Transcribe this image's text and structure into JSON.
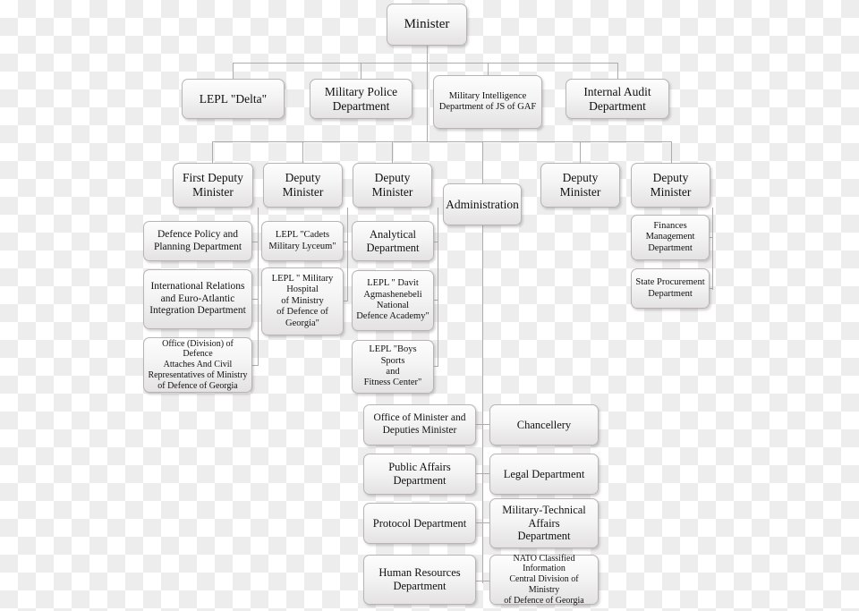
{
  "diagram": {
    "title": "Ministry of Defence of Georgia organizational structure",
    "colors": {
      "box_border": "#b9b4b4",
      "box_fill_top": "#fdfdfd",
      "box_fill_bottom": "#e4e2e2",
      "connector": "#b0abab",
      "text": "#111111",
      "canvas_checker_light": "#ffffff",
      "canvas_checker_dark": "#ededed"
    },
    "nodes": {
      "minister": "Minister",
      "lepl_delta": "LEPL \"Delta\"",
      "military_police": "Military Police\nDepartment",
      "military_intelligence": "Military Intelligence\nDepartment of JS of GAF",
      "internal_audit": "Internal Audit\nDepartment",
      "first_deputy_minister": "First Deputy\nMinister",
      "deputy_minister_2": "Deputy\nMinister",
      "deputy_minister_3": "Deputy\nMinister",
      "deputy_minister_5": "Deputy\nMinister",
      "deputy_minister_6": "Deputy\nMinister",
      "administration": "Administration",
      "defence_policy": "Defence Policy and\nPlanning Department",
      "international_relations": "International Relations\nand Euro-Atlantic\nIntegration Department",
      "office_defence_attaches": "Office (Division) of Defence\nAttaches And Civil\nRepresentatives of Ministry\nof Defence of Georgia",
      "lepl_cadets": "LEPL \"Cadets\nMilitary Lyceum\"",
      "lepl_military_hospital": "LEPL \" Military\nHospital\nof Ministry\nof Defence of\nGeorgia\"",
      "analytical_department": "Analytical\nDepartment",
      "lepl_davit_academy": "LEPL \" Davit\nAgmashenebeli\nNational\nDefence Academy\"",
      "lepl_boys_sports": "LEPL \"Boys Sports\nand\nFitness Center\"",
      "finances_management": "Finances\nManagement\nDepartment",
      "state_procurement": "State Procurement\nDepartment",
      "office_of_minister": "Office of Minister  and\nDeputies Minister",
      "chancellery": "Chancellery",
      "public_affairs": "Public Affairs\nDepartment",
      "legal_department": "Legal Department",
      "protocol_department": "Protocol Department",
      "military_technical": "Military-Technical\nAffairs\nDepartment",
      "human_resources": "Human Resources\nDepartment",
      "nato_classified": "NATO Classified Information\nCentral Division of Ministry\nof  Defence of Georgia"
    }
  }
}
